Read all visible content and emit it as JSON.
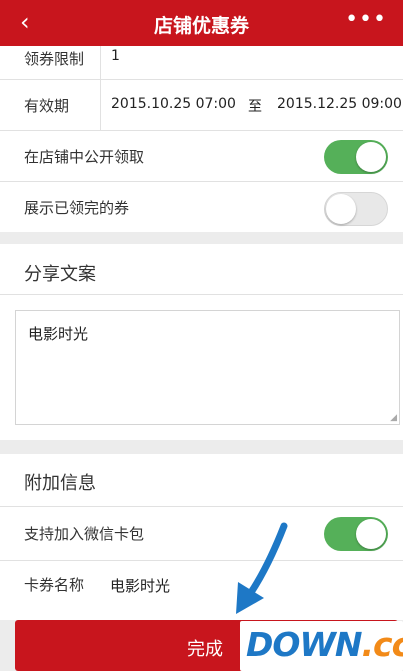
{
  "header": {
    "title": "店铺优惠券",
    "back_icon": "‹",
    "more_icon": "•••"
  },
  "rows": {
    "limit": {
      "label": "领券限制",
      "value": "1"
    },
    "validity": {
      "label": "有效期",
      "start": "2015.10.25 07:00",
      "to": "至",
      "end": "2015.12.25 09:00"
    },
    "public": {
      "label": "在店铺中公开领取",
      "toggle": "on"
    },
    "show_finished": {
      "label": "展示已领完的券",
      "toggle": "off"
    }
  },
  "share": {
    "title": "分享文案",
    "text": "电影时光"
  },
  "extra": {
    "title": "附加信息",
    "wechat": {
      "label": "支持加入微信卡包",
      "toggle": "on"
    },
    "card_name": {
      "label": "卡券名称",
      "value": "电影时光"
    }
  },
  "done_button": {
    "label": "完成"
  },
  "watermark": {
    "main": "DOWN",
    "suffix": ".cc"
  },
  "colors": {
    "brand_red": "#c8151d",
    "toggle_on": "#55b059",
    "arrow_blue": "#1e78c6"
  }
}
